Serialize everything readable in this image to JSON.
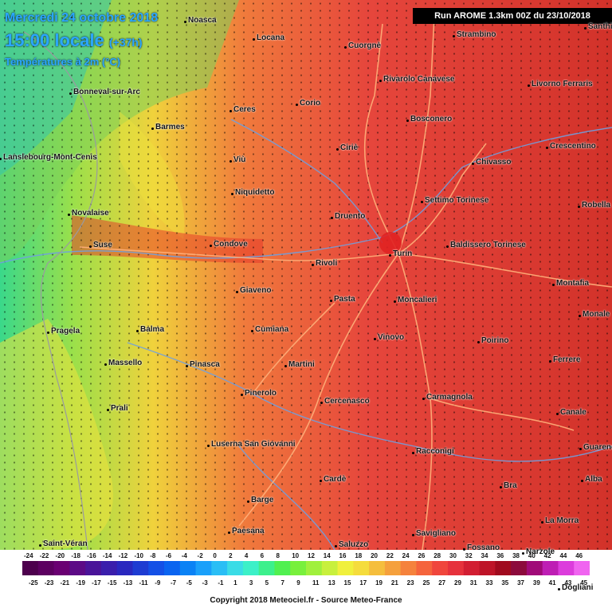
{
  "header": {
    "date": "Mercredi 24 octobre 2018",
    "time": "15:00 locale",
    "lead": "(+37h)",
    "variable": "Températures à 2m (°C)"
  },
  "run_info": "Run AROME 1.3km 00Z du 23/10/2018",
  "copyright": "Copyright 2018 Meteociel.fr - Source Meteo-France",
  "cities": [
    {
      "name": "Noasca"
    },
    {
      "name": "Locana"
    },
    {
      "name": "Cuorgnè"
    },
    {
      "name": "Strambino"
    },
    {
      "name": "Bonneval-sur-Arc"
    },
    {
      "name": "Rivarolo Canavese"
    },
    {
      "name": "Livorno Ferraris"
    },
    {
      "name": "Corio"
    },
    {
      "name": "Ceres"
    },
    {
      "name": "Barmes"
    },
    {
      "name": "Bosconero"
    },
    {
      "name": "Crescentino"
    },
    {
      "name": "Ciriè"
    },
    {
      "name": "Lanslebourg-Mont-Cenis"
    },
    {
      "name": "Viù"
    },
    {
      "name": "Chivasso"
    },
    {
      "name": "Niquidetto"
    },
    {
      "name": "Settimo Torinese"
    },
    {
      "name": "Robella"
    },
    {
      "name": "Novalaise"
    },
    {
      "name": "Druento"
    },
    {
      "name": "Suse"
    },
    {
      "name": "Condove"
    },
    {
      "name": "Baldissero Torinese"
    },
    {
      "name": "Turin"
    },
    {
      "name": "Rivoli"
    },
    {
      "name": "Montafia"
    },
    {
      "name": "Giaveno"
    },
    {
      "name": "Pasta"
    },
    {
      "name": "Moncalieri"
    },
    {
      "name": "Monale"
    },
    {
      "name": "Pragela"
    },
    {
      "name": "Balma"
    },
    {
      "name": "Cumiana"
    },
    {
      "name": "Vinovo"
    },
    {
      "name": "Poirino"
    },
    {
      "name": "Massello"
    },
    {
      "name": "Pinasca"
    },
    {
      "name": "Martini"
    },
    {
      "name": "Ferrere"
    },
    {
      "name": "Pinerolo"
    },
    {
      "name": "Carmagnola"
    },
    {
      "name": "Cercenasco"
    },
    {
      "name": "Prali"
    },
    {
      "name": "Canale"
    },
    {
      "name": "Luserna San Giovanni"
    },
    {
      "name": "Racconigi"
    },
    {
      "name": "Guarene"
    },
    {
      "name": "Cardè"
    },
    {
      "name": "Alba"
    },
    {
      "name": "Bra"
    },
    {
      "name": "Barge"
    },
    {
      "name": "La Morra"
    },
    {
      "name": "Paesana"
    },
    {
      "name": "Savigliano"
    },
    {
      "name": "Saint-Véran"
    },
    {
      "name": "Saluzzo"
    },
    {
      "name": "Narzole"
    },
    {
      "name": "Fossano"
    },
    {
      "name": "Dogliani"
    },
    {
      "name": "Santhià"
    }
  ],
  "scale": {
    "top_labels": [
      "-24",
      "-22",
      "-20",
      "-18",
      "-16",
      "-14",
      "-12",
      "-10",
      "-8",
      "-6",
      "-4",
      "-2",
      "0",
      "2",
      "4",
      "6",
      "8",
      "10",
      "12",
      "14",
      "16",
      "18",
      "20",
      "22",
      "24",
      "26",
      "28",
      "30",
      "32",
      "34",
      "36",
      "38",
      "40",
      "42",
      "44",
      "46"
    ],
    "bottom_labels": [
      "-25",
      "-23",
      "-21",
      "-19",
      "-17",
      "-15",
      "-13",
      "-11",
      "-9",
      "-7",
      "-5",
      "-3",
      "-1",
      "1",
      "3",
      "5",
      "7",
      "9",
      "11",
      "13",
      "15",
      "17",
      "19",
      "21",
      "23",
      "25",
      "27",
      "29",
      "31",
      "33",
      "35",
      "37",
      "39",
      "41",
      "43",
      "45"
    ],
    "colors": [
      "#4d004d",
      "#5c0060",
      "#6a0072",
      "#5c0a86",
      "#4a1499",
      "#3a1eac",
      "#2a28bf",
      "#1e3cd2",
      "#1450e6",
      "#0a64f0",
      "#0a82f5",
      "#1aa0fa",
      "#2abef5",
      "#3adce6",
      "#3cf0c8",
      "#3cf08c",
      "#50f050",
      "#78f03c",
      "#a0f03c",
      "#c8f03c",
      "#f0f03c",
      "#f5dc3c",
      "#f5be3c",
      "#f5a03c",
      "#f5823c",
      "#f5643c",
      "#f0463c",
      "#e6323c",
      "#d21e32",
      "#be1428",
      "#a00a1e",
      "#8c0a3c",
      "#a00a78",
      "#be1eb4",
      "#dc3cdc",
      "#f064f0"
    ]
  }
}
